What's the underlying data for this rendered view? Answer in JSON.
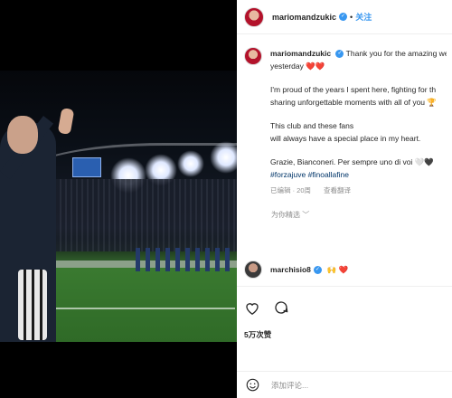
{
  "post": {
    "username": "mariomandzukic",
    "follow_label": "关注",
    "dot": "•"
  },
  "caption": {
    "lines": [
      "Thank you for the amazing we",
      "yesterday ❤️❤️",
      "I'm proud of the years I spent here, fighting for th",
      "sharing unforgettable moments with all of you 🏆",
      "This club and these fans",
      "will always have a special place in my heart.",
      "Grazie, Bianconeri. Per sempre uno di voi 🤍🖤"
    ],
    "hashtags": "#forzajuve #finoallafine",
    "time_ago": "已编辑 · 20周",
    "translate": "查看翻译"
  },
  "more_replies": "为你精选 ﹀",
  "top_comment": {
    "username": "marchisio8",
    "text": "🙌 ❤️"
  },
  "stats": {
    "views": "5万次赞"
  },
  "add_comment_placeholder": "添加评论...",
  "icons": {
    "like": "heart-icon",
    "comment": "comment-icon",
    "verified": "verified-badge-icon",
    "emoji": "smiley-icon"
  },
  "colors": {
    "link": "#3897f0",
    "hashtag": "#003569",
    "muted": "#8e8e8e"
  }
}
